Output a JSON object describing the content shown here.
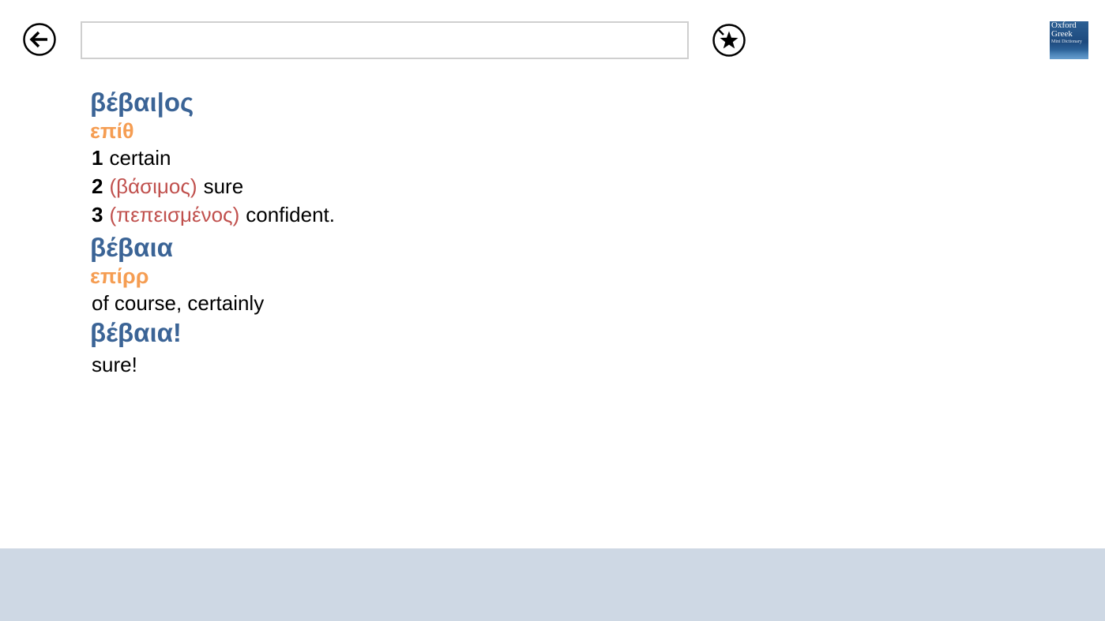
{
  "toolbar": {
    "back_icon": "arrow-left-circle-icon",
    "search": {
      "value": "",
      "placeholder": ""
    },
    "favorite_icon": "star-circle-icon"
  },
  "logo": {
    "line1": "Oxford",
    "line2": "Greek",
    "line3": "Mini Dictionary"
  },
  "entries": [
    {
      "headword": "βέβαι|ος",
      "pos": "επίθ",
      "senses": [
        {
          "num": "1",
          "context": "",
          "gloss": "certain"
        },
        {
          "num": "2",
          "context": "(βάσιμος)",
          "gloss": "sure"
        },
        {
          "num": "3",
          "context": "(πεπεισμένος)",
          "gloss": "confident."
        }
      ]
    },
    {
      "headword": "βέβαια",
      "pos": "επίρρ",
      "gloss": "of course, certainly"
    },
    {
      "headword": "βέβαια!",
      "gloss": "sure!"
    }
  ],
  "colors": {
    "headword": "#3b6496",
    "pos": "#f59d52",
    "context": "#c0504d",
    "bottom_bar": "#ced8e4"
  }
}
